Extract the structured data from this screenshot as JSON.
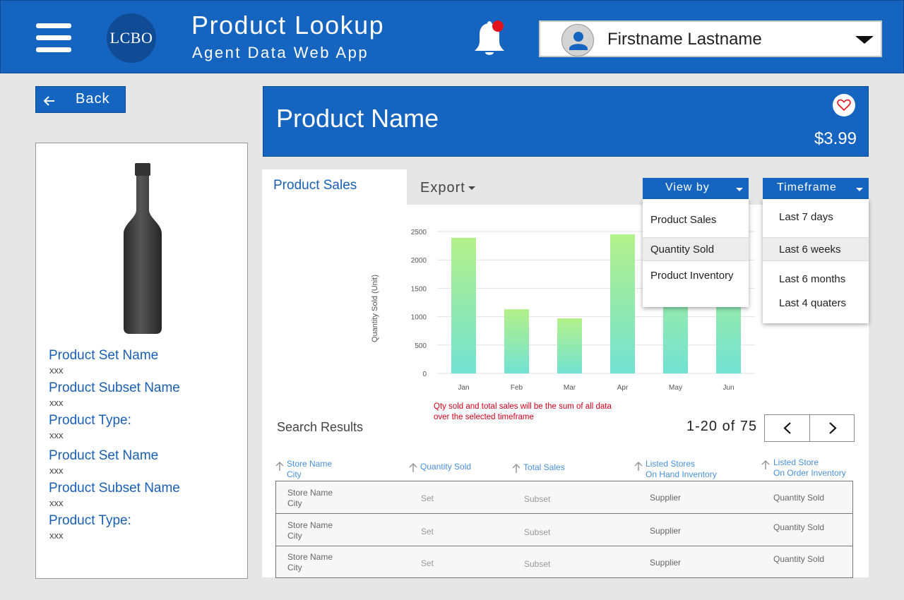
{
  "header": {
    "logo_text": "LCBO",
    "title": "Product Lookup",
    "subtitle": "Agent Data Web App",
    "user_name": "Firstname Lastname"
  },
  "back_label": "Back",
  "product": {
    "name": "Product Name",
    "price": "$3.99",
    "attributes": [
      {
        "label": "Product Set Name",
        "value": "xxx"
      },
      {
        "label": "Product Subset Name",
        "value": "xxx"
      },
      {
        "label": "Product Type:",
        "value": "xxx"
      },
      {
        "label": "Product Set Name",
        "value": "xxx"
      },
      {
        "label": "Product Subset Name",
        "value": "xxx"
      },
      {
        "label": "Product Type:",
        "value": "xxx"
      }
    ]
  },
  "tabs": {
    "active": "Product Sales",
    "export": "Export"
  },
  "view_by": {
    "label": "View by",
    "options": [
      "Product Sales",
      "Quantity Sold",
      "Product Inventory"
    ],
    "selected": "Quantity Sold"
  },
  "timeframe": {
    "label": "Timeframe",
    "options": [
      "Last 7 days",
      "Last 6 weeks",
      "Last 6 months",
      "Last 4 quaters"
    ],
    "selected": "Last 6 weeks"
  },
  "chart_data": {
    "type": "bar",
    "categories": [
      "Jan",
      "Feb",
      "Mar",
      "Apr",
      "May",
      "Jun"
    ],
    "values": [
      2390,
      1130,
      970,
      2450,
      2450,
      2450
    ],
    "ylabel": "Quantity Sold (Unit)",
    "ylim": [
      0,
      2500
    ],
    "yticks": [
      0,
      500,
      1000,
      1500,
      2000,
      2500
    ],
    "grid": true,
    "colors": {
      "top": "#b4f08a",
      "bottom": "#72e2d2"
    }
  },
  "note": "Qty sold and total sales will be the sum of all data over the selected timeframe",
  "search": {
    "title": "Search Results",
    "pagination": "1-20 of 75"
  },
  "table": {
    "columns": [
      {
        "line1": "Store Name",
        "line2": "City"
      },
      {
        "line1": "Quantity Sold",
        "line2": ""
      },
      {
        "line1": "Total Sales",
        "line2": ""
      },
      {
        "line1": "Listed Stores",
        "line2": "On Hand Inventory"
      },
      {
        "line1": "Listed Store",
        "line2": "On Order Inventory"
      }
    ],
    "rows": [
      {
        "store": "Store Name",
        "city": "City",
        "set": "Set",
        "subset": "Subset",
        "supplier": "Supplier",
        "qty": "Quantity Sold"
      },
      {
        "store": "Store Name",
        "city": "City",
        "set": "Set",
        "subset": "Subset",
        "supplier": "Supplier",
        "qty": "Quantity Sold"
      },
      {
        "store": "Store Name",
        "city": "City",
        "set": "Set",
        "subset": "Subset",
        "supplier": "Supplier",
        "qty": "Quantity Sold"
      }
    ]
  },
  "colors": {
    "brand_blue": "#1565c0",
    "link_blue": "#1a5fb4",
    "note_red": "#d0021b",
    "notification_dot": "#e0121b"
  }
}
